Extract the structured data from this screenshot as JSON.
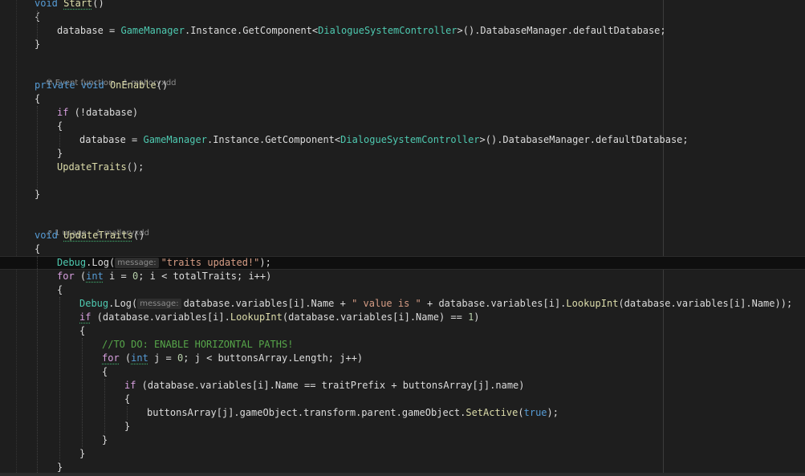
{
  "editor": {
    "language": "C#",
    "code_lens": {
      "on_enable": {
        "event_label": "Event function",
        "author": "malloryxdd"
      },
      "update_traits": {
        "usage_label": "1 usage",
        "author": "malloryxdd"
      }
    },
    "inlay_hint_label": "message:",
    "tokens": {
      "void": "void",
      "private": "private",
      "start": "Start",
      "on_enable": "OnEnable",
      "update_traits": "UpdateTraits",
      "parens": "()",
      "open_brace": "{",
      "close_brace": "}",
      "database": "database",
      "assign": " = ",
      "game_manager": "GameManager",
      "instance_get_component": ".Instance.GetComponent<",
      "dialogue_controller": "DialogueSystemController",
      "db_manager_tail": ">().DatabaseManager.defaultDatabase;",
      "if_kw": "if",
      "not_database": " (!database)",
      "update_traits_call": "UpdateTraits",
      "call_end": "();",
      "debug": "Debug",
      "log": ".Log(",
      "traits_updated_str": "\"traits updated!\"",
      "stmt_end": ");",
      "for_kw": "for",
      "int_kw": "int",
      "for_i_a": " i = ",
      "zero": "0",
      "for_i_b": "; i < totalTraits; i++)",
      "db_vars_name": "database.variables[i].Name + ",
      "value_is_str": "\" value is \"",
      "plus_db_vars": " + database.variables[i].",
      "lookup_int": "LookupInt",
      "lookup_arg_end": "(database.variables[i].Name));",
      "if_lookup_a": " (database.variables[i].",
      "if_lookup_b": "(database.variables[i].Name) == ",
      "one": "1",
      "close_paren": ")",
      "todo_comment": "//TO DO: ENABLE HORIZONTAL PATHS!",
      "for_j_a": " j = ",
      "for_j_b": "; j < buttonsArray.Length; j++)",
      "if_name_cmp": " (database.variables[i].Name == traitPrefix + buttonsArray[j].name)",
      "set_active_a": "buttonsArray[j].gameObject.transform.parent.gameObject.",
      "set_active": "SetActive",
      "open_paren": "(",
      "true_kw": "true",
      "stmt_end2": ");"
    }
  }
}
